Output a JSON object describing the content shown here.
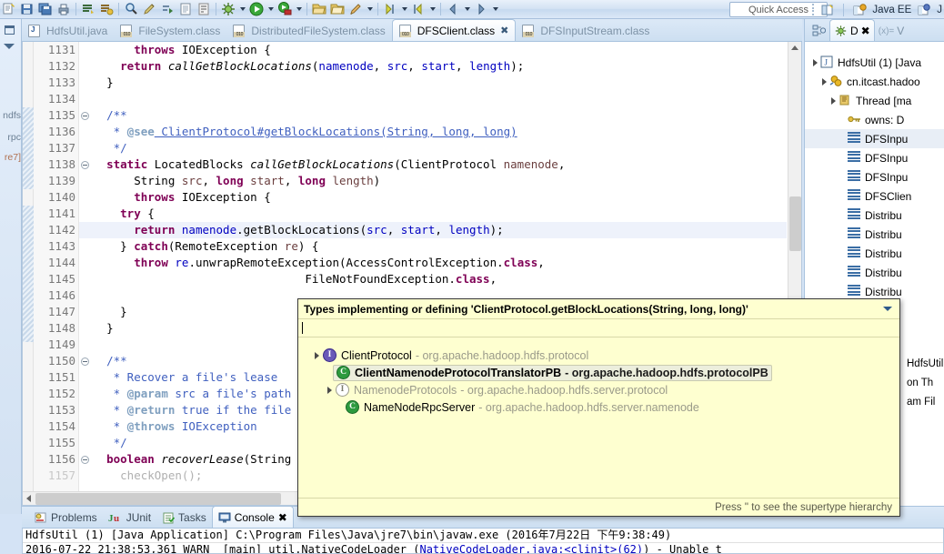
{
  "app": {
    "quick_access": "Quick Access",
    "perspectives": [
      {
        "label": "Java EE",
        "icon": "javaee-perspective-icon"
      },
      {
        "label": "J",
        "icon": "java-perspective-icon"
      }
    ]
  },
  "toolbar": {
    "icons": [
      "new-wizard-icon",
      "save-icon",
      "save-all-icon",
      "print-icon",
      "build-all-icon",
      "build-project-icon",
      "search-icon",
      "pencil-icon",
      "refactor-icon",
      "open-type-icon",
      "format-icon",
      "debug-icon",
      "run-icon",
      "external-tools-icon",
      "open-folder-icon",
      "open-folder2-icon",
      "paint-icon",
      "next-annotation-icon",
      "prev-annotation-icon",
      "back-icon",
      "forward-icon"
    ]
  },
  "editor": {
    "tabs": [
      {
        "label": "HdfsUtil.java",
        "icon": "java-file-icon",
        "active": false,
        "closeable": false
      },
      {
        "label": "FileSystem.class",
        "icon": "class-file-icon",
        "active": false,
        "closeable": false
      },
      {
        "label": "DistributedFileSystem.class",
        "icon": "class-file-icon",
        "active": false,
        "closeable": false
      },
      {
        "label": "DFSClient.class",
        "icon": "class-file-icon",
        "active": true,
        "closeable": true
      },
      {
        "label": "DFSInputStream.class",
        "icon": "class-file-icon",
        "active": false,
        "closeable": false
      }
    ],
    "close_glyph": "✖",
    "controls": {
      "minimize": "minimize-icon",
      "maximize": "maximize-icon"
    },
    "first_line_number": 1131,
    "lines": [
      {
        "n": "1131",
        "fold": false,
        "hl": false
      },
      {
        "n": "1132",
        "fold": false,
        "hl": false
      },
      {
        "n": "1133",
        "fold": false,
        "hl": false
      },
      {
        "n": "1134",
        "fold": false,
        "hl": false
      },
      {
        "n": "1135",
        "fold": true,
        "hl": false
      },
      {
        "n": "1136",
        "fold": false,
        "hl": false
      },
      {
        "n": "1137",
        "fold": false,
        "hl": false
      },
      {
        "n": "1138",
        "fold": true,
        "hl": false
      },
      {
        "n": "1139",
        "fold": false,
        "hl": false
      },
      {
        "n": "1140",
        "fold": false,
        "hl": false
      },
      {
        "n": "1141",
        "fold": false,
        "hl": false
      },
      {
        "n": "1142",
        "fold": false,
        "hl": true
      },
      {
        "n": "1143",
        "fold": false,
        "hl": false
      },
      {
        "n": "1144",
        "fold": false,
        "hl": false
      },
      {
        "n": "1145",
        "fold": false,
        "hl": false
      },
      {
        "n": "1146",
        "fold": false,
        "hl": false
      },
      {
        "n": "1147",
        "fold": false,
        "hl": false
      },
      {
        "n": "1148",
        "fold": false,
        "hl": false
      },
      {
        "n": "1149",
        "fold": false,
        "hl": false
      },
      {
        "n": "1150",
        "fold": true,
        "hl": false
      },
      {
        "n": "1151",
        "fold": false,
        "hl": false
      },
      {
        "n": "1152",
        "fold": false,
        "hl": false
      },
      {
        "n": "1153",
        "fold": false,
        "hl": false
      },
      {
        "n": "1154",
        "fold": false,
        "hl": false
      },
      {
        "n": "1155",
        "fold": false,
        "hl": false
      },
      {
        "n": "1156",
        "fold": true,
        "hl": false
      },
      {
        "n": "1157",
        "fold": false,
        "hl": false
      }
    ],
    "code_text": [
      "        throws IOException {",
      "      return callGetBlockLocations(namenode, src, start, length);",
      "    }",
      "",
      "    /**",
      "     * @see ClientProtocol#getBlockLocations(String, long, long)",
      "     */",
      "    static LocatedBlocks callGetBlockLocations(ClientProtocol namenode,",
      "        String src, long start, long length)",
      "        throws IOException {",
      "      try {",
      "        return namenode.getBlockLocations(src, start, length);",
      "      } catch(RemoteException re) {",
      "        throw re.unwrapRemoteException(AccessControlException.class,",
      "                                 FileNotFoundException.class,",
      "",
      "      }",
      "    }",
      "",
      "    /**",
      "     * Recover a file's lease",
      "     * @param src a file's path",
      "     * @return true if the file",
      "     * @throws IOException",
      "     */",
      "    boolean recoverLease(String",
      "      checkOpen();"
    ]
  },
  "popup": {
    "title": "Types implementing or defining 'ClientProtocol.getBlockLocations(String, long, long)'",
    "menu_icon": "chevron-down-icon",
    "filter_value": "",
    "footer": "Press '' to see the supertype hierarchy",
    "tree": [
      {
        "label": "ClientProtocol",
        "package": "- org.apache.hadoop.hdfs.protocol",
        "icon": "interface-icon",
        "icon_color": "#5a4aa8",
        "indent": 0,
        "expanded": true,
        "selected": false
      },
      {
        "label": "ClientNamenodeProtocolTranslatorPB",
        "package": "- org.apache.hadoop.hdfs.protocolPB",
        "icon": "class-icon",
        "icon_color": "#2d9a3e",
        "indent": 1,
        "expanded": false,
        "selected": true
      },
      {
        "label": "NamenodeProtocols",
        "package": "- org.apache.hadoop.hdfs.server.protocol",
        "icon": "interface-icon",
        "icon_color": "#9a9a8a",
        "indent": 0,
        "expanded": true,
        "selected": false
      },
      {
        "label": "NameNodeRpcServer",
        "package": "- org.apache.hadoop.hdfs.server.namenode",
        "icon": "class-icon",
        "icon_color": "#2d9a3e",
        "indent": 1,
        "expanded": false,
        "selected": false
      }
    ]
  },
  "right_panel": {
    "tabs": [
      {
        "label": "",
        "icon": "outline-icon",
        "active": false
      },
      {
        "label": "D",
        "icon": "debug-icon",
        "active": true,
        "closeable": true
      },
      {
        "label": "V",
        "icon": "variables-icon",
        "active": false
      }
    ],
    "close_glyph": "✖",
    "var_prefix": "(x)=",
    "tree": [
      {
        "label": "HdfsUtil (1) [Java",
        "icon": "launch-config-icon",
        "indent": 0,
        "expanded": true,
        "selected": false
      },
      {
        "label": "cn.itcast.hadoo",
        "icon": "java-process-icon",
        "indent": 1,
        "expanded": true,
        "selected": false
      },
      {
        "label": "Thread [ma",
        "icon": "thread-icon",
        "indent": 2,
        "expanded": true,
        "selected": false
      },
      {
        "label": "owns: D",
        "icon": "monitor-key-icon",
        "indent": 3,
        "expanded": false,
        "selected": false
      },
      {
        "label": "DFSInpu",
        "icon": "stack-frame-icon",
        "indent": 3,
        "expanded": false,
        "selected": true
      },
      {
        "label": "DFSInpu",
        "icon": "stack-frame-running-icon",
        "indent": 3,
        "expanded": false,
        "selected": false
      },
      {
        "label": "DFSInpu",
        "icon": "stack-frame-icon",
        "indent": 3,
        "expanded": false,
        "selected": false
      },
      {
        "label": "DFSClien",
        "icon": "stack-frame-icon",
        "indent": 3,
        "expanded": false,
        "selected": false
      },
      {
        "label": "Distribu",
        "icon": "stack-frame-icon",
        "indent": 3,
        "expanded": false,
        "selected": false
      },
      {
        "label": "Distribu",
        "icon": "stack-frame-icon",
        "indent": 3,
        "expanded": false,
        "selected": false
      },
      {
        "label": "Distribu",
        "icon": "stack-frame-icon",
        "indent": 3,
        "expanded": false,
        "selected": false
      },
      {
        "label": "Distribu",
        "icon": "stack-frame-icon",
        "indent": 3,
        "expanded": false,
        "selected": false
      },
      {
        "label": "Distribu",
        "icon": "stack-frame-icon",
        "indent": 3,
        "expanded": false,
        "selected": false
      }
    ],
    "occluded_rows": [
      "HdfsUtil",
      "on Th",
      "am Fil"
    ]
  },
  "left_strip": {
    "restore_icon": "restore-icon",
    "menu_icon": "view-menu-icon",
    "labels": [
      "ndfs",
      "rpc",
      "re7]"
    ]
  },
  "bottom_panel": {
    "tabs": [
      {
        "label": "Problems",
        "icon": "problems-icon",
        "active": false
      },
      {
        "label": "JUnit",
        "icon": "junit-icon",
        "active": false
      },
      {
        "label": "Tasks",
        "icon": "tasks-icon",
        "active": false
      },
      {
        "label": "Console",
        "icon": "console-icon",
        "active": true,
        "closeable": true
      }
    ],
    "close_glyph": "✖",
    "console_header": "HdfsUtil (1) [Java Application] C:\\Program Files\\Java\\jre7\\bin\\javaw.exe (2016年7月22日 下午9:38:49)",
    "console_lines": [
      {
        "pre": "2016-07-22 21:38:53,361 WARN  [main] util.NativeCodeLoader (",
        "link": "NativeCodeLoader.java:<clinit>(62)",
        "post": ") - Unable t"
      }
    ]
  }
}
